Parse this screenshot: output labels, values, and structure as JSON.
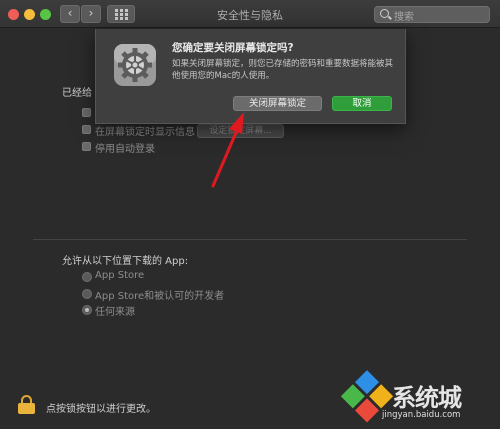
{
  "window": {
    "title": "安全性与隐私",
    "search_placeholder": "搜索",
    "nav_back": "‹",
    "nav_forward": "›"
  },
  "general": {
    "section_label": "已经给",
    "options": [
      {
        "label": "在屏幕锁定时显示信息",
        "checked": false
      },
      {
        "label": "停用自动登录",
        "checked": false
      }
    ],
    "set_message_button": "设定锁定屏幕..."
  },
  "downloads": {
    "label": "允许从以下位置下载的 App:",
    "options": [
      {
        "label": "App Store",
        "selected": false
      },
      {
        "label": "App Store和被认可的开发者",
        "selected": false
      },
      {
        "label": "任何来源",
        "selected": true
      }
    ]
  },
  "footer": {
    "lock_text": "点按锁按钮以进行更改。",
    "lock_icon": "padlock-icon"
  },
  "dialog": {
    "title": "您确定要关闭屏幕锁定吗?",
    "message": "如果关闭屏幕锁定，则您已存储的密码和重要数据将能被其他使用您的Mac的人使用。",
    "confirm_label": "关闭屏幕锁定",
    "cancel_label": "取消",
    "icon": "gear-icon"
  },
  "watermark": {
    "brand_text": "系统城",
    "url": "jingyan.baidu.com"
  },
  "colors": {
    "cancel_button": "#2f9e3a",
    "annotation_arrow": "#e0191f",
    "lock": "#eab43c"
  }
}
